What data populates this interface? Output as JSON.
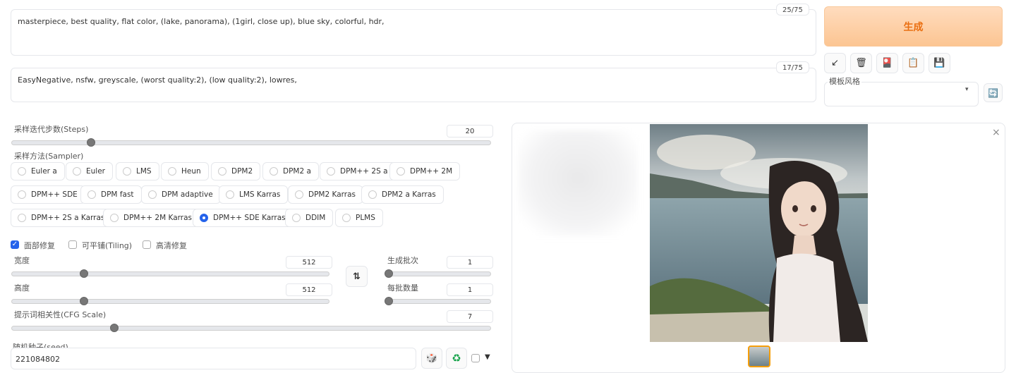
{
  "prompt": {
    "positive_text": "masterpiece, best quality, flat color, (lake, panorama), (1girl, close up), blue sky, colorful, hdr,",
    "positive_tokens": "25/75",
    "negative_text": "EasyNegative, nsfw, greyscale, (worst quality:2), (low quality:2), lowres,",
    "negative_tokens": "17/75"
  },
  "toolbar": {
    "generate_label": "生成",
    "tools": [
      {
        "icon": "arrow-icon",
        "glyph": "↙"
      },
      {
        "icon": "trash-icon",
        "glyph": "🗑"
      },
      {
        "icon": "red-card-icon",
        "glyph": "🎴"
      },
      {
        "icon": "clipboard-icon",
        "glyph": "📋"
      },
      {
        "icon": "save-icon",
        "glyph": "💾"
      }
    ],
    "style_label": "模板风格",
    "refresh_glyph": "🔄"
  },
  "steps": {
    "label": "采样迭代步数(Steps)",
    "value": "20",
    "fraction": 0.16
  },
  "sampler": {
    "label": "采样方法(Sampler)",
    "options": [
      "Euler a",
      "Euler",
      "LMS",
      "Heun",
      "DPM2",
      "DPM2 a",
      "DPM++ 2S a",
      "DPM++ 2M",
      "DPM++ SDE",
      "DPM fast",
      "DPM adaptive",
      "LMS Karras",
      "DPM2 Karras",
      "DPM2 a Karras",
      "DPM++ 2S a Karras",
      "DPM++ 2M Karras",
      "DPM++ SDE Karras",
      "DDIM",
      "PLMS"
    ],
    "selected": "DPM++ SDE Karras"
  },
  "options": {
    "face_restore": "面部修复",
    "tiling": "可平铺(Tiling)",
    "hires": "高清修复"
  },
  "width": {
    "label": "宽度",
    "value": "512",
    "fraction": 0.22
  },
  "height": {
    "label": "高度",
    "value": "512",
    "fraction": 0.22
  },
  "swap_glyph": "⇅",
  "batch_count": {
    "label": "生成批次",
    "value": "1",
    "fraction": 0.0
  },
  "batch_size": {
    "label": "每批数量",
    "value": "1",
    "fraction": 0.0
  },
  "cfg": {
    "label": "提示词相关性(CFG Scale)",
    "value": "7",
    "fraction": 0.21
  },
  "seed": {
    "label": "随机种子(seed)",
    "value": "221084802",
    "dice_glyph": "🎲",
    "recycle_glyph": "♻",
    "extra_glyph": "▼"
  },
  "gallery": {
    "close_glyph": "×"
  }
}
